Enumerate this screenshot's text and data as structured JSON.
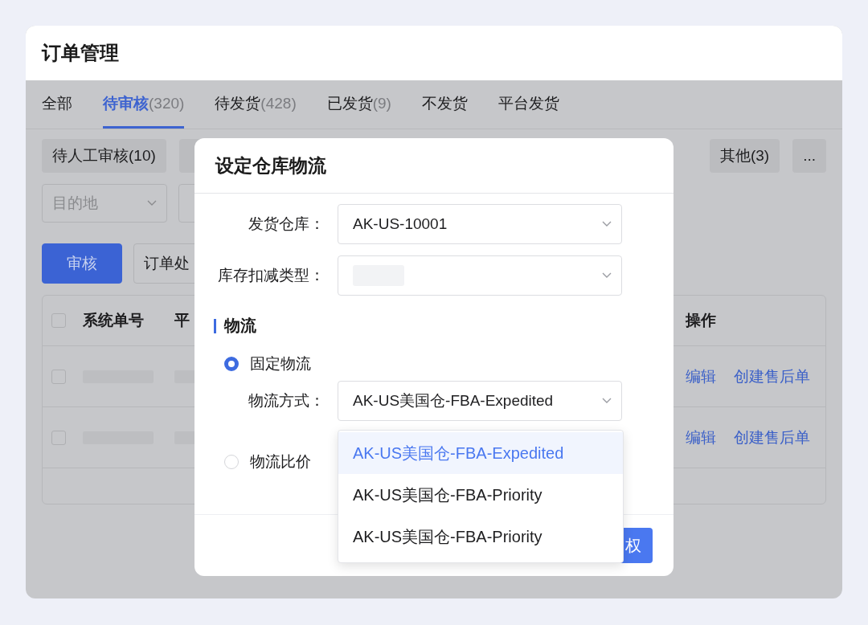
{
  "page": {
    "title": "订单管理"
  },
  "tabs": [
    {
      "label": "全部",
      "selected": false
    },
    {
      "label": "待审核",
      "count": "(320)",
      "selected": true
    },
    {
      "label": "待发货",
      "count": "(428)",
      "selected": false
    },
    {
      "label": "已发货",
      "count": "(9)",
      "selected": false
    },
    {
      "label": "不发货",
      "selected": false
    },
    {
      "label": "平台发货",
      "selected": false
    }
  ],
  "filter_chips": [
    "待人工审核(10)",
    "其他(3)",
    "..."
  ],
  "filters": [
    {
      "placeholder": "目的地"
    }
  ],
  "actions": [
    {
      "label": "审核",
      "kind": "primary"
    },
    {
      "label": "订单处",
      "kind": "default"
    }
  ],
  "table": {
    "select_all_checked": false,
    "columns": [
      "系统单号",
      "平",
      "操作"
    ],
    "rows": [
      {
        "checked": false,
        "actions": [
          "编辑",
          "创建售后单"
        ]
      },
      {
        "checked": false,
        "actions": [
          "编辑",
          "创建售后单"
        ]
      }
    ]
  },
  "dialog": {
    "title": "设定仓库物流",
    "fields": [
      {
        "label": "发货仓库：",
        "value": "AK-US-10001"
      },
      {
        "label": "库存扣减类型："
      }
    ],
    "section": "物流",
    "options": [
      {
        "label": "固定物流",
        "selected": true
      },
      {
        "label": "物流比价",
        "selected": false
      }
    ],
    "method": {
      "label": "物流方式：",
      "value": "AK-US美国仓-FBA-Expedited"
    },
    "dropdown": [
      {
        "label": "AK-US美国仓-FBA-Expedited",
        "selected": true
      },
      {
        "label": "AK-US美国仓-FBA-Priority",
        "selected": false
      },
      {
        "label": "AK-US美国仓-FBA-Priority",
        "selected": false
      }
    ],
    "footer_button": "权"
  }
}
